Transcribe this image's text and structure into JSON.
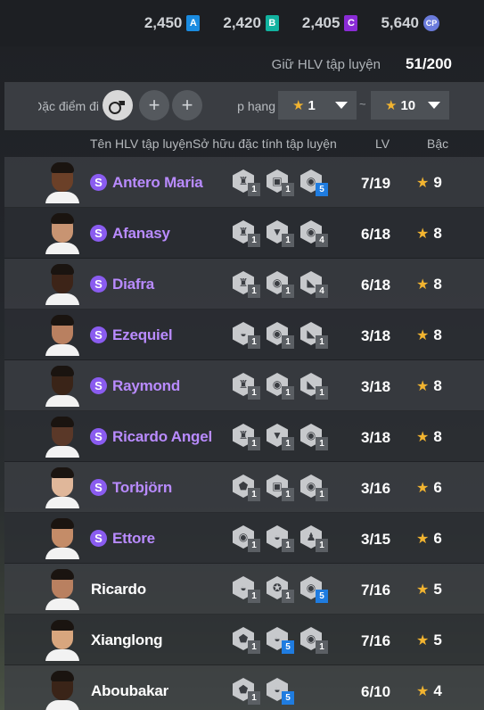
{
  "currencies": [
    {
      "value": "2,450",
      "badge": "A",
      "color": "#1a8be0"
    },
    {
      "value": "2,420",
      "badge": "B",
      "color": "#12b3a0"
    },
    {
      "value": "2,405",
      "badge": "C",
      "color": "#8a2bd6"
    },
    {
      "value": "5,640",
      "badge": "CP",
      "color": "#6a7bdc"
    }
  ],
  "holding": {
    "label": "Giữ HLV tập luyện",
    "count": "51/200"
  },
  "filters": {
    "trait_label": "Đặc điểm đi",
    "rank_label": "Xếp hạng",
    "rank_min": "1",
    "rank_sep": "~",
    "rank_max": "10"
  },
  "columns": {
    "name": "Tên HLV tập luyện",
    "traits": "Sở hữu đặc tính tập luyện",
    "lv": "LV",
    "rank": "Bậc"
  },
  "coaches": [
    {
      "name": "Antero Maria",
      "special": true,
      "lv": "7/19",
      "rank": "9",
      "skin": "#6b4028",
      "traits": [
        {
          "icon": "trophy-icon",
          "level": "1",
          "blue": false
        },
        {
          "icon": "lock-icon",
          "level": "1",
          "blue": false
        },
        {
          "icon": "ball-icon",
          "level": "5",
          "blue": true
        }
      ]
    },
    {
      "name": "Afanasy",
      "special": true,
      "lv": "6/18",
      "rank": "8",
      "skin": "#c89472",
      "traits": [
        {
          "icon": "trophy-icon",
          "level": "1",
          "blue": false
        },
        {
          "icon": "tie-icon",
          "level": "1",
          "blue": false
        },
        {
          "icon": "ball-icon",
          "level": "4",
          "blue": false
        }
      ]
    },
    {
      "name": "Diafra",
      "special": true,
      "lv": "6/18",
      "rank": "8",
      "skin": "#3d2418",
      "traits": [
        {
          "icon": "trophy-icon",
          "level": "1",
          "blue": false
        },
        {
          "icon": "ball-icon",
          "level": "1",
          "blue": false
        },
        {
          "icon": "boot-icon",
          "level": "4",
          "blue": false
        }
      ]
    },
    {
      "name": "Ezequiel",
      "special": true,
      "lv": "3/18",
      "rank": "8",
      "skin": "#b98060",
      "traits": [
        {
          "icon": "whistle-icon",
          "level": "1",
          "blue": false
        },
        {
          "icon": "ball-icon",
          "level": "1",
          "blue": false
        },
        {
          "icon": "boot-icon",
          "level": "1",
          "blue": false
        }
      ]
    },
    {
      "name": "Raymond",
      "special": true,
      "lv": "3/18",
      "rank": "8",
      "skin": "#3a2418",
      "traits": [
        {
          "icon": "trophy-icon",
          "level": "1",
          "blue": false
        },
        {
          "icon": "ball-icon",
          "level": "1",
          "blue": false
        },
        {
          "icon": "boot-icon",
          "level": "1",
          "blue": false
        }
      ]
    },
    {
      "name": "Ricardo Angel",
      "special": true,
      "lv": "3/18",
      "rank": "8",
      "skin": "#5a3828",
      "traits": [
        {
          "icon": "trophy-icon",
          "level": "1",
          "blue": false
        },
        {
          "icon": "tie-icon",
          "level": "1",
          "blue": false
        },
        {
          "icon": "ball-icon",
          "level": "1",
          "blue": false
        }
      ]
    },
    {
      "name": "Torbjörn",
      "special": true,
      "lv": "3/16",
      "rank": "6",
      "skin": "#e0b79a",
      "traits": [
        {
          "icon": "shield-icon",
          "level": "1",
          "blue": false
        },
        {
          "icon": "lock-icon",
          "level": "1",
          "blue": false
        },
        {
          "icon": "ball-icon",
          "level": "1",
          "blue": false
        }
      ]
    },
    {
      "name": "Ettore",
      "special": true,
      "lv": "3/15",
      "rank": "6",
      "skin": "#c48c68",
      "traits": [
        {
          "icon": "ball-icon",
          "level": "1",
          "blue": false
        },
        {
          "icon": "whistle-icon",
          "level": "1",
          "blue": false
        },
        {
          "icon": "player-icon",
          "level": "1",
          "blue": false
        }
      ]
    },
    {
      "name": "Ricardo",
      "special": false,
      "lv": "7/16",
      "rank": "5",
      "skin": "#b98060",
      "traits": [
        {
          "icon": "whistle-icon",
          "level": "1",
          "blue": false
        },
        {
          "icon": "medal-icon",
          "level": "1",
          "blue": false
        },
        {
          "icon": "ball-icon",
          "level": "5",
          "blue": true
        }
      ]
    },
    {
      "name": "Xianglong",
      "special": false,
      "lv": "7/16",
      "rank": "5",
      "skin": "#d8a67e",
      "traits": [
        {
          "icon": "shield-icon",
          "level": "1",
          "blue": false
        },
        {
          "icon": "whistle-icon",
          "level": "5",
          "blue": true
        },
        {
          "icon": "ball-icon",
          "level": "1",
          "blue": false
        }
      ]
    },
    {
      "name": "Aboubakar",
      "special": false,
      "lv": "6/10",
      "rank": "4",
      "skin": "#3a2418",
      "traits": [
        {
          "icon": "shield-icon",
          "level": "1",
          "blue": false
        },
        {
          "icon": "whistle-icon",
          "level": "5",
          "blue": true
        }
      ]
    }
  ]
}
